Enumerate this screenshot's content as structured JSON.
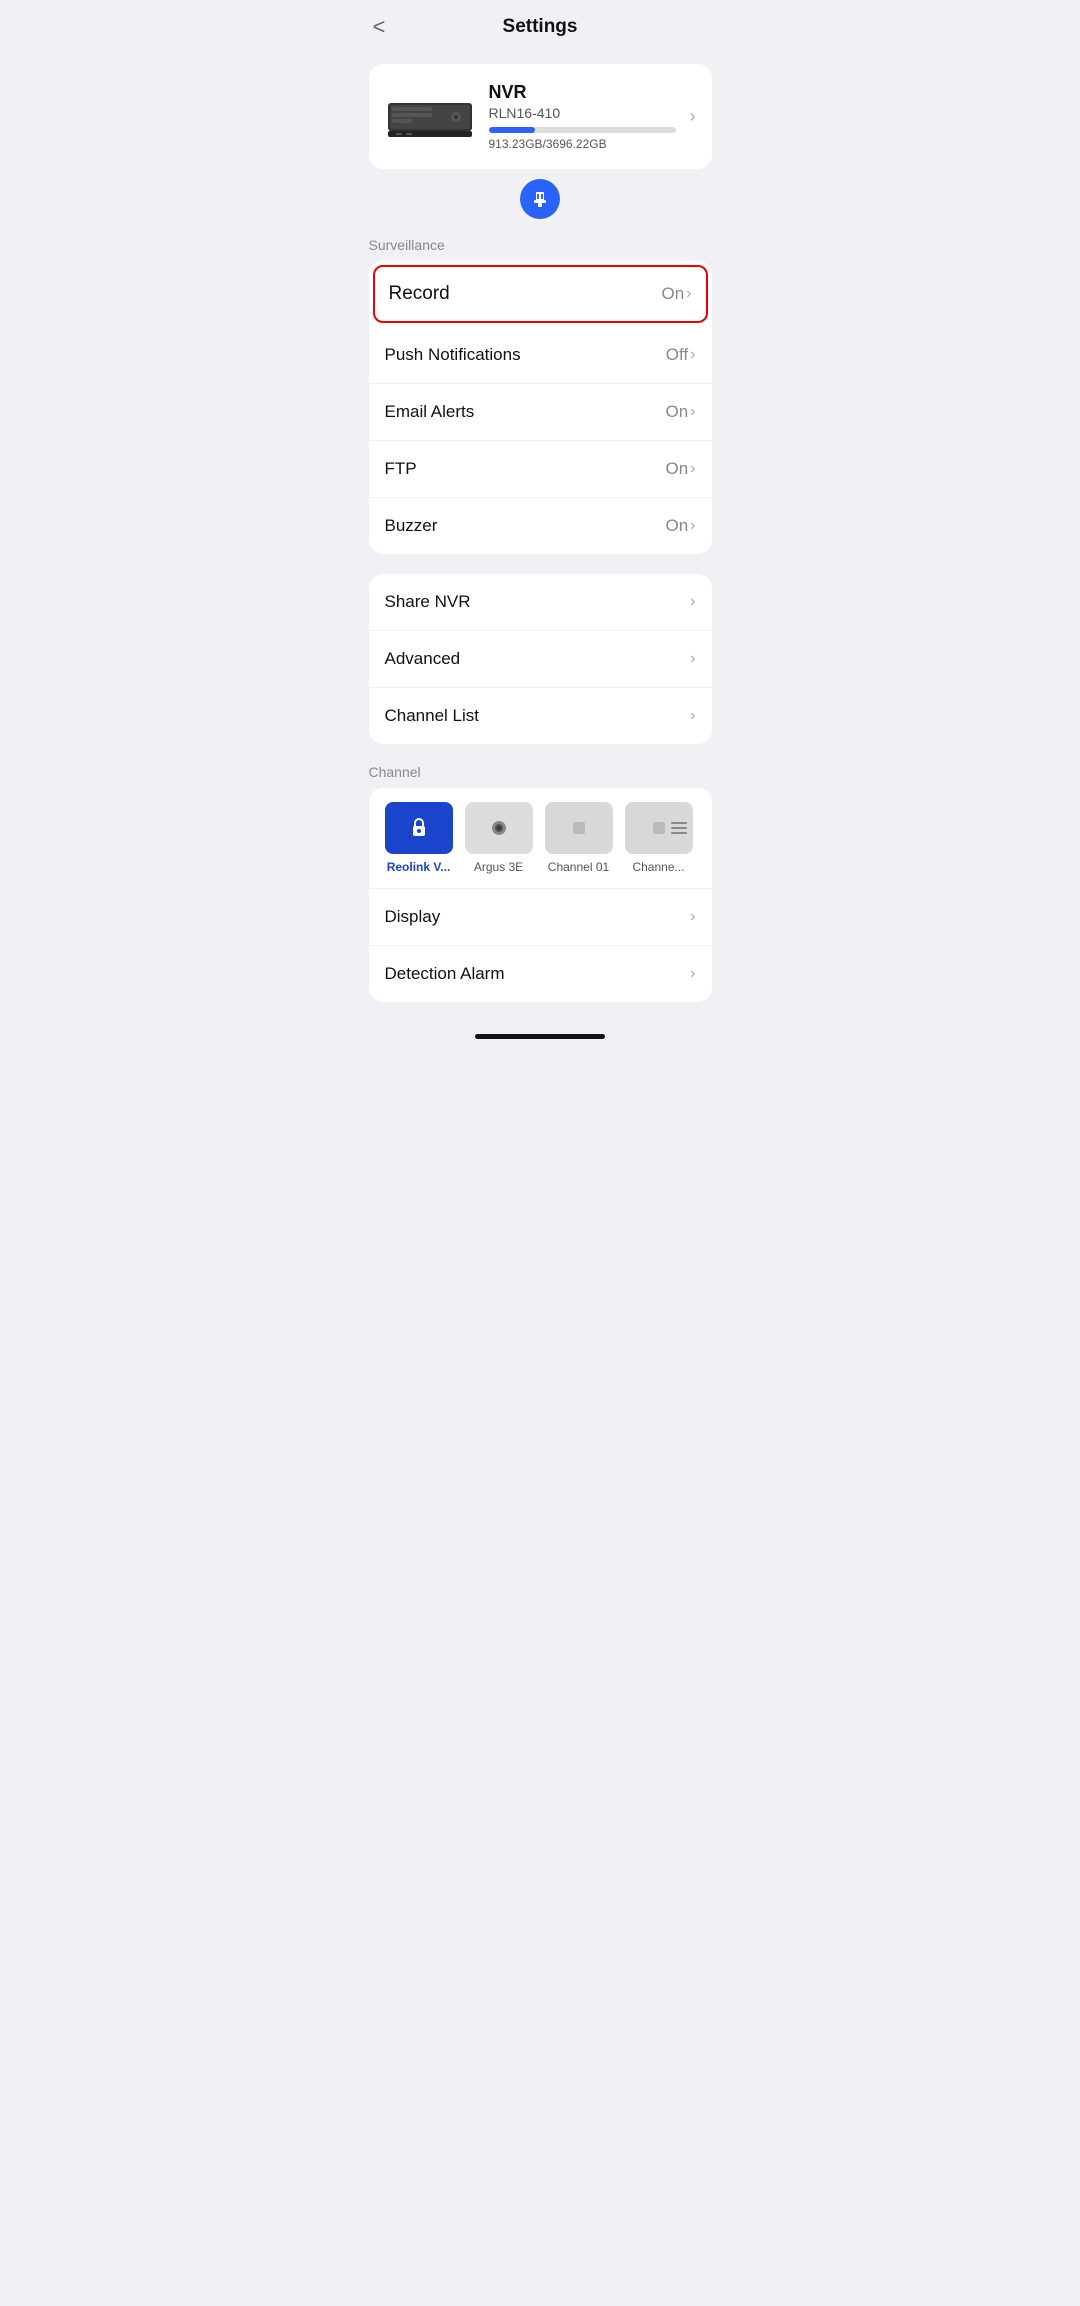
{
  "header": {
    "back_label": "<",
    "title": "Settings"
  },
  "nvr_card": {
    "name": "NVR",
    "model": "RLN16-410",
    "storage_used": "913.23GB",
    "storage_total": "3696.22GB",
    "storage_percent": 24.7,
    "chevron": "›"
  },
  "section_surveillance": {
    "label": "Surveillance",
    "items": [
      {
        "label": "Record",
        "value": "On",
        "chevron": "›",
        "highlighted": true
      },
      {
        "label": "Push Notifications",
        "value": "Off",
        "chevron": "›",
        "highlighted": false
      },
      {
        "label": "Email Alerts",
        "value": "On",
        "chevron": "›",
        "highlighted": false
      },
      {
        "label": "FTP",
        "value": "On",
        "chevron": "›",
        "highlighted": false
      },
      {
        "label": "Buzzer",
        "value": "On",
        "chevron": "›",
        "highlighted": false
      }
    ]
  },
  "section_general": {
    "items": [
      {
        "label": "Share NVR",
        "chevron": "›"
      },
      {
        "label": "Advanced",
        "chevron": "›"
      },
      {
        "label": "Channel List",
        "chevron": "›"
      }
    ]
  },
  "section_channel": {
    "label": "Channel",
    "channels": [
      {
        "label": "Reolink V...",
        "active": true
      },
      {
        "label": "Argus 3E",
        "active": false
      },
      {
        "label": "Channel 01",
        "active": false
      },
      {
        "label": "Channe...",
        "active": false
      }
    ],
    "items": [
      {
        "label": "Display",
        "chevron": "›"
      },
      {
        "label": "Detection Alarm",
        "chevron": "›"
      }
    ]
  }
}
